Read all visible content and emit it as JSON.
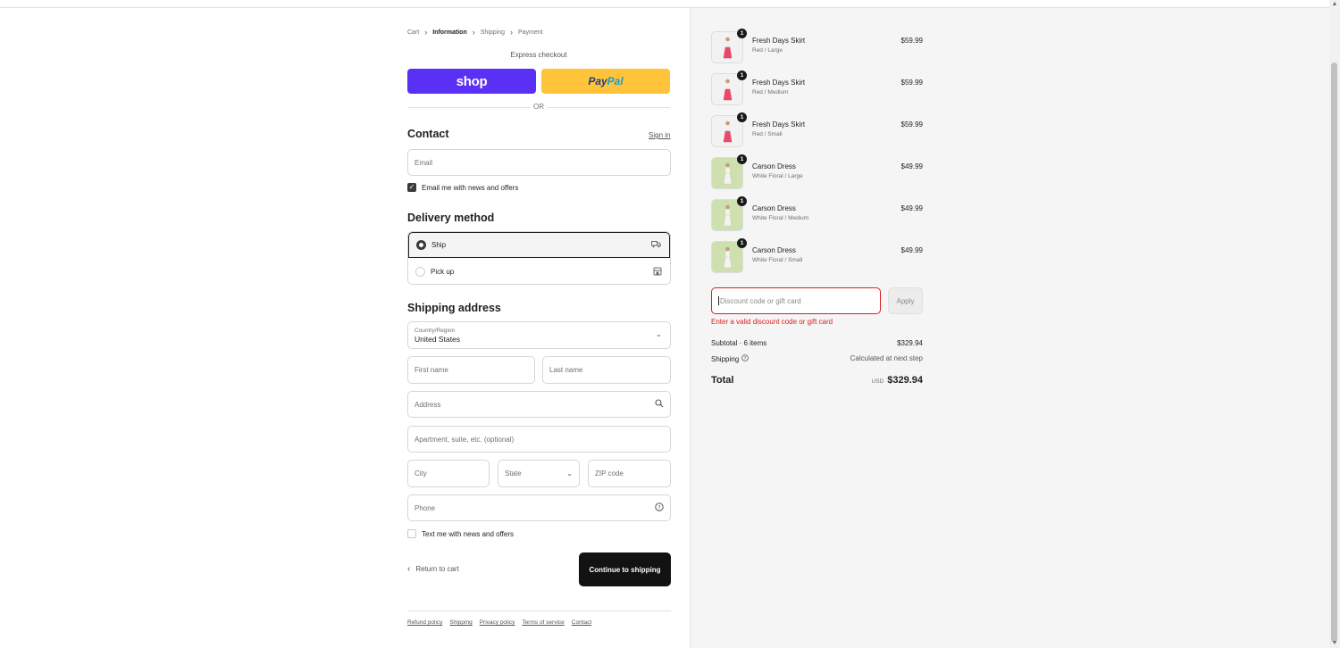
{
  "breadcrumb": {
    "items": [
      "Cart",
      "Information",
      "Shipping",
      "Payment"
    ],
    "current_index": 1
  },
  "express": {
    "label": "Express checkout",
    "shop_label": "shop",
    "paypal_label_1": "Pay",
    "paypal_label_2": "Pal",
    "or_label": "OR"
  },
  "contact": {
    "title": "Contact",
    "signin_label": "Sign in",
    "email_placeholder": "Email",
    "news_label": "Email me with news and offers",
    "news_checked": true
  },
  "delivery": {
    "title": "Delivery method",
    "options": [
      {
        "label": "Ship",
        "icon": "truck-icon",
        "selected": true
      },
      {
        "label": "Pick up",
        "icon": "store-icon",
        "selected": false
      }
    ]
  },
  "shipping": {
    "title": "Shipping address",
    "country_label": "Country/Region",
    "country_value": "United States",
    "first_name": "First name",
    "last_name": "Last name",
    "address": "Address",
    "apartment": "Apartment, suite, etc. (optional)",
    "city": "City",
    "state": "State",
    "zip": "ZIP code",
    "phone": "Phone",
    "text_label": "Text me with news and offers"
  },
  "actions": {
    "return_label": "Return to cart",
    "continue_label": "Continue to shipping"
  },
  "footer": {
    "links": [
      "Refund policy",
      "Shipping",
      "Privacy policy",
      "Terms of service",
      "Contact"
    ]
  },
  "cart": {
    "items": [
      {
        "name": "Fresh Days Skirt",
        "variant": "Red / Large",
        "price": "$59.99",
        "qty": "1",
        "color": "#e8496b"
      },
      {
        "name": "Fresh Days Skirt",
        "variant": "Red / Medium",
        "price": "$59.99",
        "qty": "1",
        "color": "#e8496b"
      },
      {
        "name": "Fresh Days Skirt",
        "variant": "Red / Small",
        "price": "$59.99",
        "qty": "1",
        "color": "#e8496b"
      },
      {
        "name": "Carson Dress",
        "variant": "White Floral / Large",
        "price": "$49.99",
        "qty": "1",
        "color": "#f4f4ee"
      },
      {
        "name": "Carson Dress",
        "variant": "White Floral / Medium",
        "price": "$49.99",
        "qty": "1",
        "color": "#f4f4ee"
      },
      {
        "name": "Carson Dress",
        "variant": "White Floral / Small",
        "price": "$49.99",
        "qty": "1",
        "color": "#f4f4ee"
      }
    ],
    "discount_placeholder": "Discount code or gift card",
    "apply_label": "Apply",
    "error": "Enter a valid discount code or gift card",
    "subtotal_label": "Subtotal · 6 items",
    "subtotal_value": "$329.94",
    "shipping_label": "Shipping",
    "shipping_value": "Calculated at next step",
    "total_label": "Total",
    "currency": "USD",
    "total_value": "$329.94"
  },
  "colors": {
    "shop_purple": "#5a31f4",
    "paypal_yellow": "#ffc439",
    "error_red": "#dd1d1d",
    "continue_bg": "#121212"
  }
}
